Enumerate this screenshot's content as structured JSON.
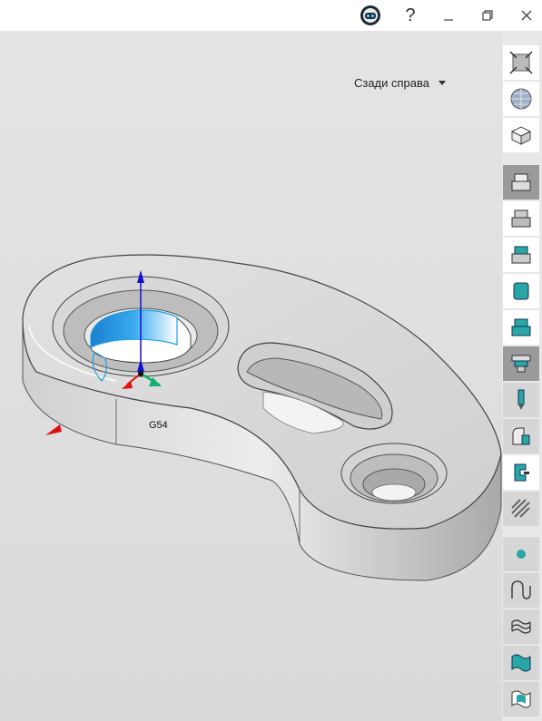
{
  "window": {
    "assistant_icon": "robot-face-icon",
    "help_label": "?",
    "minimize_icon": "minimize-icon",
    "restore_icon": "restore-icon",
    "close_icon": "close-icon"
  },
  "view": {
    "orientation_label": "Сзади справа",
    "origin_label": "G54"
  },
  "rail": {
    "view_tools": [
      "fit-view-icon",
      "shaded-view-icon",
      "wireframe-box-icon"
    ],
    "operation_tools": [
      "stock-icon",
      "part-icon",
      "fixture-icon",
      "cylinder-icon",
      "top-body-icon",
      "hole-tool-icon",
      "drill-icon",
      "corner-icon",
      "clamp-icon",
      "pattern-icon",
      "point-icon",
      "curve-icon",
      "surface-wave-icon",
      "surface-teal-icon",
      "surface-flag-icon"
    ]
  },
  "colors": {
    "accent": "#2aa6a6",
    "selection": "#1aa0e0",
    "x_axis": "#e01010",
    "y_axis": "#10b070",
    "z_axis": "#1010d0"
  }
}
